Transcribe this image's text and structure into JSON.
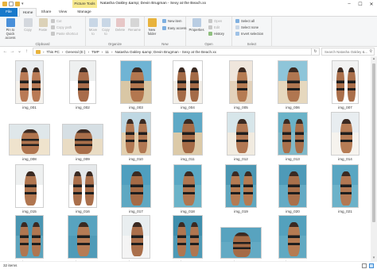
{
  "window": {
    "title": "Natasha Oakley &amp; Devin Brugman - Sexy at the Beach.xx",
    "contextual_tab": "Picture Tools",
    "controls": {
      "minimize": "–",
      "maximize": "☐",
      "close": "✕"
    }
  },
  "tabs": {
    "file": "File",
    "home": "Home",
    "share": "Share",
    "view": "View",
    "manage": "Manage"
  },
  "ribbon": {
    "clipboard": {
      "label": "Clipboard",
      "pin": "Pin to Quick access",
      "copy": "Copy",
      "paste": "Paste",
      "cut": "Cut",
      "copy_path": "Copy path",
      "paste_shortcut": "Paste shortcut"
    },
    "organize": {
      "label": "Organize",
      "move_to": "Move to",
      "copy_to": "Copy to",
      "delete": "Delete",
      "rename": "Rename"
    },
    "new": {
      "label": "New",
      "new_folder": "New folder",
      "new_item": "New item",
      "easy_access": "Easy access"
    },
    "open": {
      "label": "Open",
      "properties": "Properties",
      "open": "Open",
      "edit": "Edit",
      "history": "History"
    },
    "select": {
      "label": "Select",
      "select_all": "Select all",
      "select_none": "Select none",
      "invert": "Invert selection"
    }
  },
  "address": {
    "back": "←",
    "forward": "→",
    "recent": "⌄",
    "up": "↑",
    "separator": "›",
    "crumbs": [
      "This PC",
      "General (E:)",
      "TMP",
      "11",
      "Natasha Oakley &amp; Devin Brugman - Sexy at the Beach.xx"
    ],
    "refresh": "↻",
    "search_placeholder": "Search Natasha Oakley &...",
    "search_glyph": "⚲"
  },
  "files": [
    {
      "name": "img_001",
      "sky": "#e9ecef",
      "bg": "#f4f1ec",
      "skin": "#b97a55"
    },
    {
      "name": "img_002",
      "sky": "#eef0f0",
      "bg": "#ffffff",
      "skin": "#a86c4a"
    },
    {
      "name": "img_003",
      "sky": "#6fb4d4",
      "bg": "#d9c7a5",
      "skin": "#b3774f"
    },
    {
      "name": "img_004",
      "sky": "#ffffff",
      "bg": "#f3efe8",
      "skin": "#a46b47"
    },
    {
      "name": "img_005",
      "sky": "#efe6dc",
      "bg": "#e3d2bb",
      "skin": "#b57b52"
    },
    {
      "name": "img_006",
      "sky": "#8ec5d9",
      "bg": "#e6d8be",
      "skin": "#b07650"
    },
    {
      "name": "img_007",
      "sky": "#f2f2f2",
      "bg": "#ffffff",
      "skin": "#aa6f4b"
    },
    {
      "name": "img_008",
      "sky": "#dfe7ea",
      "bg": "#efe3cd",
      "skin": "#b0754f"
    },
    {
      "name": "img_009",
      "sky": "#d6dfe4",
      "bg": "#e9dcc4",
      "skin": "#a96f4a"
    },
    {
      "name": "img_010",
      "sky": "#bfd8e3",
      "bg": "#e2cfae",
      "skin": "#b17852"
    },
    {
      "name": "img_011",
      "sky": "#5fa9c6",
      "bg": "#dccaa8",
      "skin": "#a56b46"
    },
    {
      "name": "img_012",
      "sky": "#d7e6ea",
      "bg": "#f1ebe0",
      "skin": "#b27853"
    },
    {
      "name": "img_013",
      "sky": "#6bb3c8",
      "bg": "#7fb9c9",
      "skin": "#a9704b"
    },
    {
      "name": "img_014",
      "sky": "#e8edf0",
      "bg": "#f6f3ee",
      "skin": "#b67c55"
    },
    {
      "name": "img_015",
      "sky": "#eef0f0",
      "bg": "#ffffff",
      "skin": "#b07650"
    },
    {
      "name": "img_016",
      "sky": "#e5e8ea",
      "bg": "#ffffff",
      "skin": "#aa6f4b"
    },
    {
      "name": "img_017",
      "sky": "#4f9fbf",
      "bg": "#5ea8c2",
      "skin": "#a56b46"
    },
    {
      "name": "img_018",
      "sky": "#5aa8c4",
      "bg": "#6bb3c8",
      "skin": "#b07650"
    },
    {
      "name": "img_019",
      "sky": "#4b97b3",
      "bg": "#5fa7bf",
      "skin": "#b57b52"
    },
    {
      "name": "img_020",
      "sky": "#4e9ab8",
      "bg": "#63aac4",
      "skin": "#a9704b"
    },
    {
      "name": "img_021",
      "sky": "#5aa6c2",
      "bg": "#6cb2c9",
      "skin": "#b27853"
    },
    {
      "name": "img_022",
      "sky": "#4a96b2",
      "bg": "#5ca4bd",
      "skin": "#b07650"
    },
    {
      "name": "img_023",
      "sky": "#58a3bf",
      "bg": "#4f9bb8",
      "skin": "#b67c55"
    },
    {
      "name": "img_024",
      "sky": "#e9eef0",
      "bg": "#f4f4f4",
      "skin": "#aa6f4b"
    },
    {
      "name": "img_025",
      "sky": "#3f8fad",
      "bg": "#4d9ab6",
      "skin": "#b07650"
    },
    {
      "name": "img_026",
      "sky": "#58a3bf",
      "bg": "#63aac4",
      "skin": "#a56b46"
    },
    {
      "name": "img_027",
      "sky": "#54a1bd",
      "bg": "#61a9c2",
      "skin": "#b57b52"
    }
  ],
  "status": {
    "count": "32 items"
  },
  "colors": {
    "accent": "#1979ca",
    "picture_tools": "#f7e98f"
  }
}
